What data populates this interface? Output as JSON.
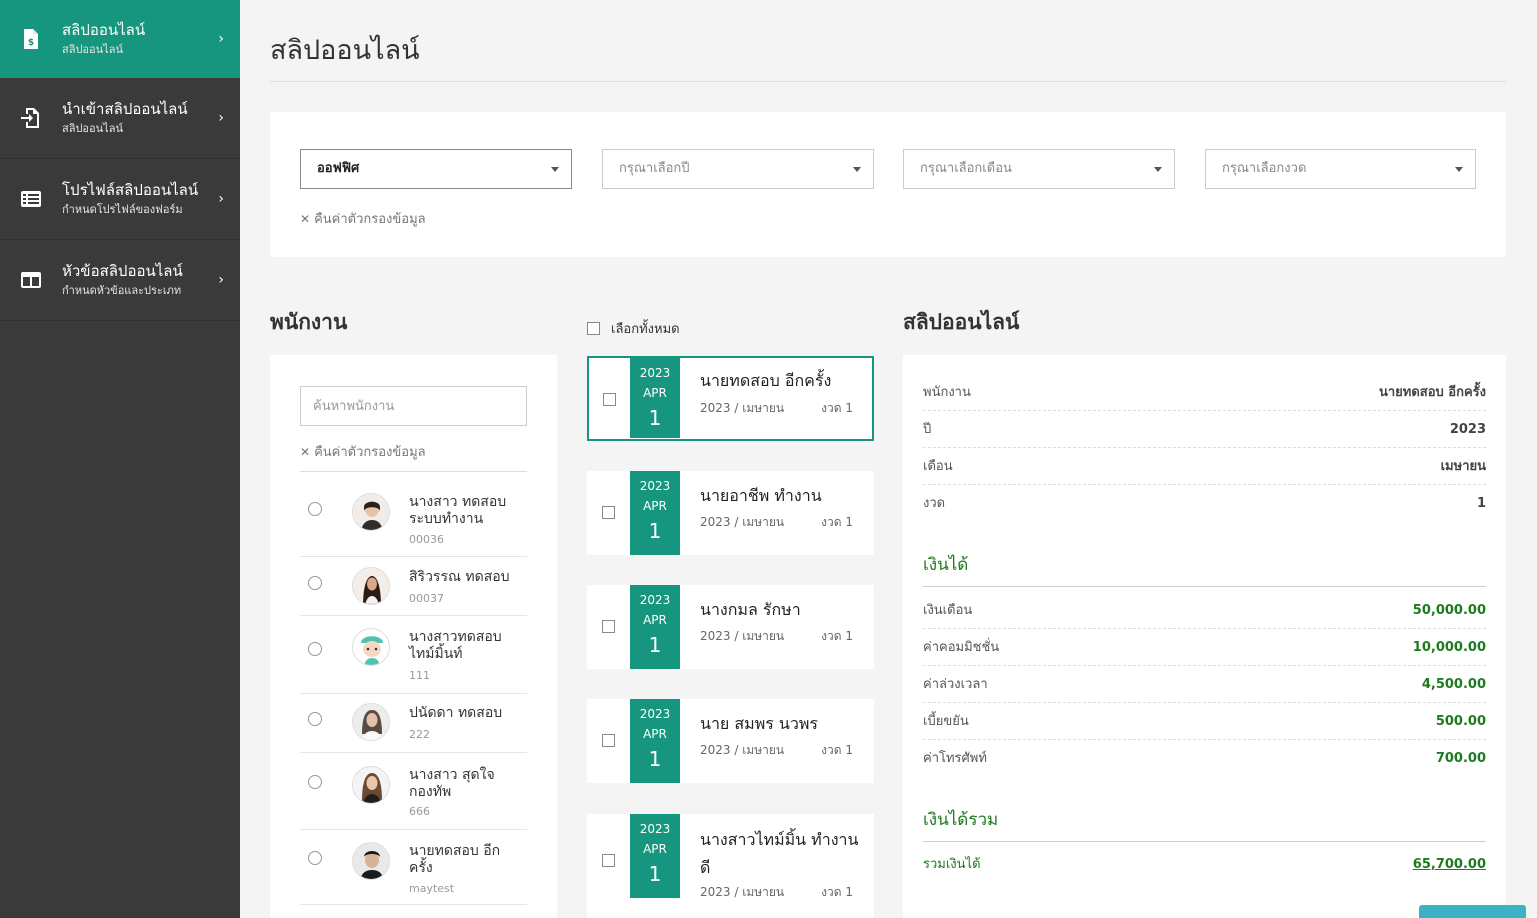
{
  "sidebar": {
    "items": [
      {
        "title": "สลิปออนไลน์",
        "subtitle": "สลิปออนไลน์",
        "icon": "file-dollar-icon",
        "active": true
      },
      {
        "title": "นำเข้าสลิปออนไลน์",
        "subtitle": "สลิปออนไลน์",
        "icon": "file-import-icon",
        "active": false
      },
      {
        "title": "โปรไฟล์สลิปออนไลน์",
        "subtitle": "กำหนดโปรไฟล์ของฟอร์ม",
        "icon": "list-table-icon",
        "active": false
      },
      {
        "title": "หัวข้อสลิปออนไลน์",
        "subtitle": "กำหนดหัวข้อและประเภท",
        "icon": "columns-icon",
        "active": false
      }
    ],
    "chevron": "›"
  },
  "page": {
    "title": "สลิปออนไลน์"
  },
  "filters": {
    "office": "ออฟฟิศ",
    "year_placeholder": "กรุณาเลือกปี",
    "month_placeholder": "กรุณาเลือกเดือน",
    "period_placeholder": "กรุณาเลือกงวด",
    "reset": "คืนค่าตัวกรองข้อมูล"
  },
  "employees": {
    "title": "พนักงาน",
    "search_placeholder": "ค้นหาพนักงาน",
    "reset": "คืนค่าตัวกรองข้อมูล",
    "list": [
      {
        "name": "นางสาว ทดสอบ ระบบทำงาน",
        "code": "00036"
      },
      {
        "name": "สิริวรรณ ทดสอบ",
        "code": "00037"
      },
      {
        "name": "นางสาวทดสอบ ไทม์มิ้นท์",
        "code": "111"
      },
      {
        "name": "ปนัดดา ทดสอบ",
        "code": "222"
      },
      {
        "name": "นางสาว สุดใจ กองทัพ",
        "code": "666"
      },
      {
        "name": "นายทดสอบ อีก ครั้ง",
        "code": "maytest"
      }
    ]
  },
  "slips": {
    "select_all": "เลือกทั้งหมด",
    "items": [
      {
        "year": "2023",
        "month": "APR",
        "day": "1",
        "name": "นายทดสอบ อีกครั้ง",
        "period_text": "2023 / เมษายน",
        "round": "งวด 1",
        "active": true
      },
      {
        "year": "2023",
        "month": "APR",
        "day": "1",
        "name": "นายอาชีพ ทำงาน",
        "period_text": "2023 / เมษายน",
        "round": "งวด 1",
        "active": false
      },
      {
        "year": "2023",
        "month": "APR",
        "day": "1",
        "name": "นางกมล รักษา",
        "period_text": "2023 / เมษายน",
        "round": "งวด 1",
        "active": false
      },
      {
        "year": "2023",
        "month": "APR",
        "day": "1",
        "name": "นาย สมพร นวพร",
        "period_text": "2023 / เมษายน",
        "round": "งวด 1",
        "active": false
      },
      {
        "year": "2023",
        "month": "APR",
        "day": "1",
        "name": "นางสาวไทม์มิ้น ทำงาน ดี",
        "period_text": "2023 / เมษายน",
        "round": "งวด 1",
        "active": false
      }
    ]
  },
  "detail": {
    "title": "สลิปออนไลน์",
    "info": [
      {
        "label": "พนักงาน",
        "value": "นายทดสอบ อีกครั้ง"
      },
      {
        "label": "ปี",
        "value": "2023"
      },
      {
        "label": "เดือน",
        "value": "เมษายน"
      },
      {
        "label": "งวด",
        "value": "1"
      }
    ],
    "income_title": "เงินได้",
    "income": [
      {
        "label": "เงินเดือน",
        "value": "50,000.00"
      },
      {
        "label": "ค่าคอมมิชชั่น",
        "value": "10,000.00"
      },
      {
        "label": "ค่าล่วงเวลา",
        "value": "4,500.00"
      },
      {
        "label": "เบี้ยขยัน",
        "value": "500.00"
      },
      {
        "label": "ค่าโทรศัพท์",
        "value": "700.00"
      }
    ],
    "total_title": "เงินได้รวม",
    "total_label": "รวมเงินได้",
    "total_value": "65,700.00"
  },
  "colors": {
    "accent": "#17967f",
    "sidebar_bg": "#3a3a3a",
    "money_green": "#1e7a1e"
  }
}
